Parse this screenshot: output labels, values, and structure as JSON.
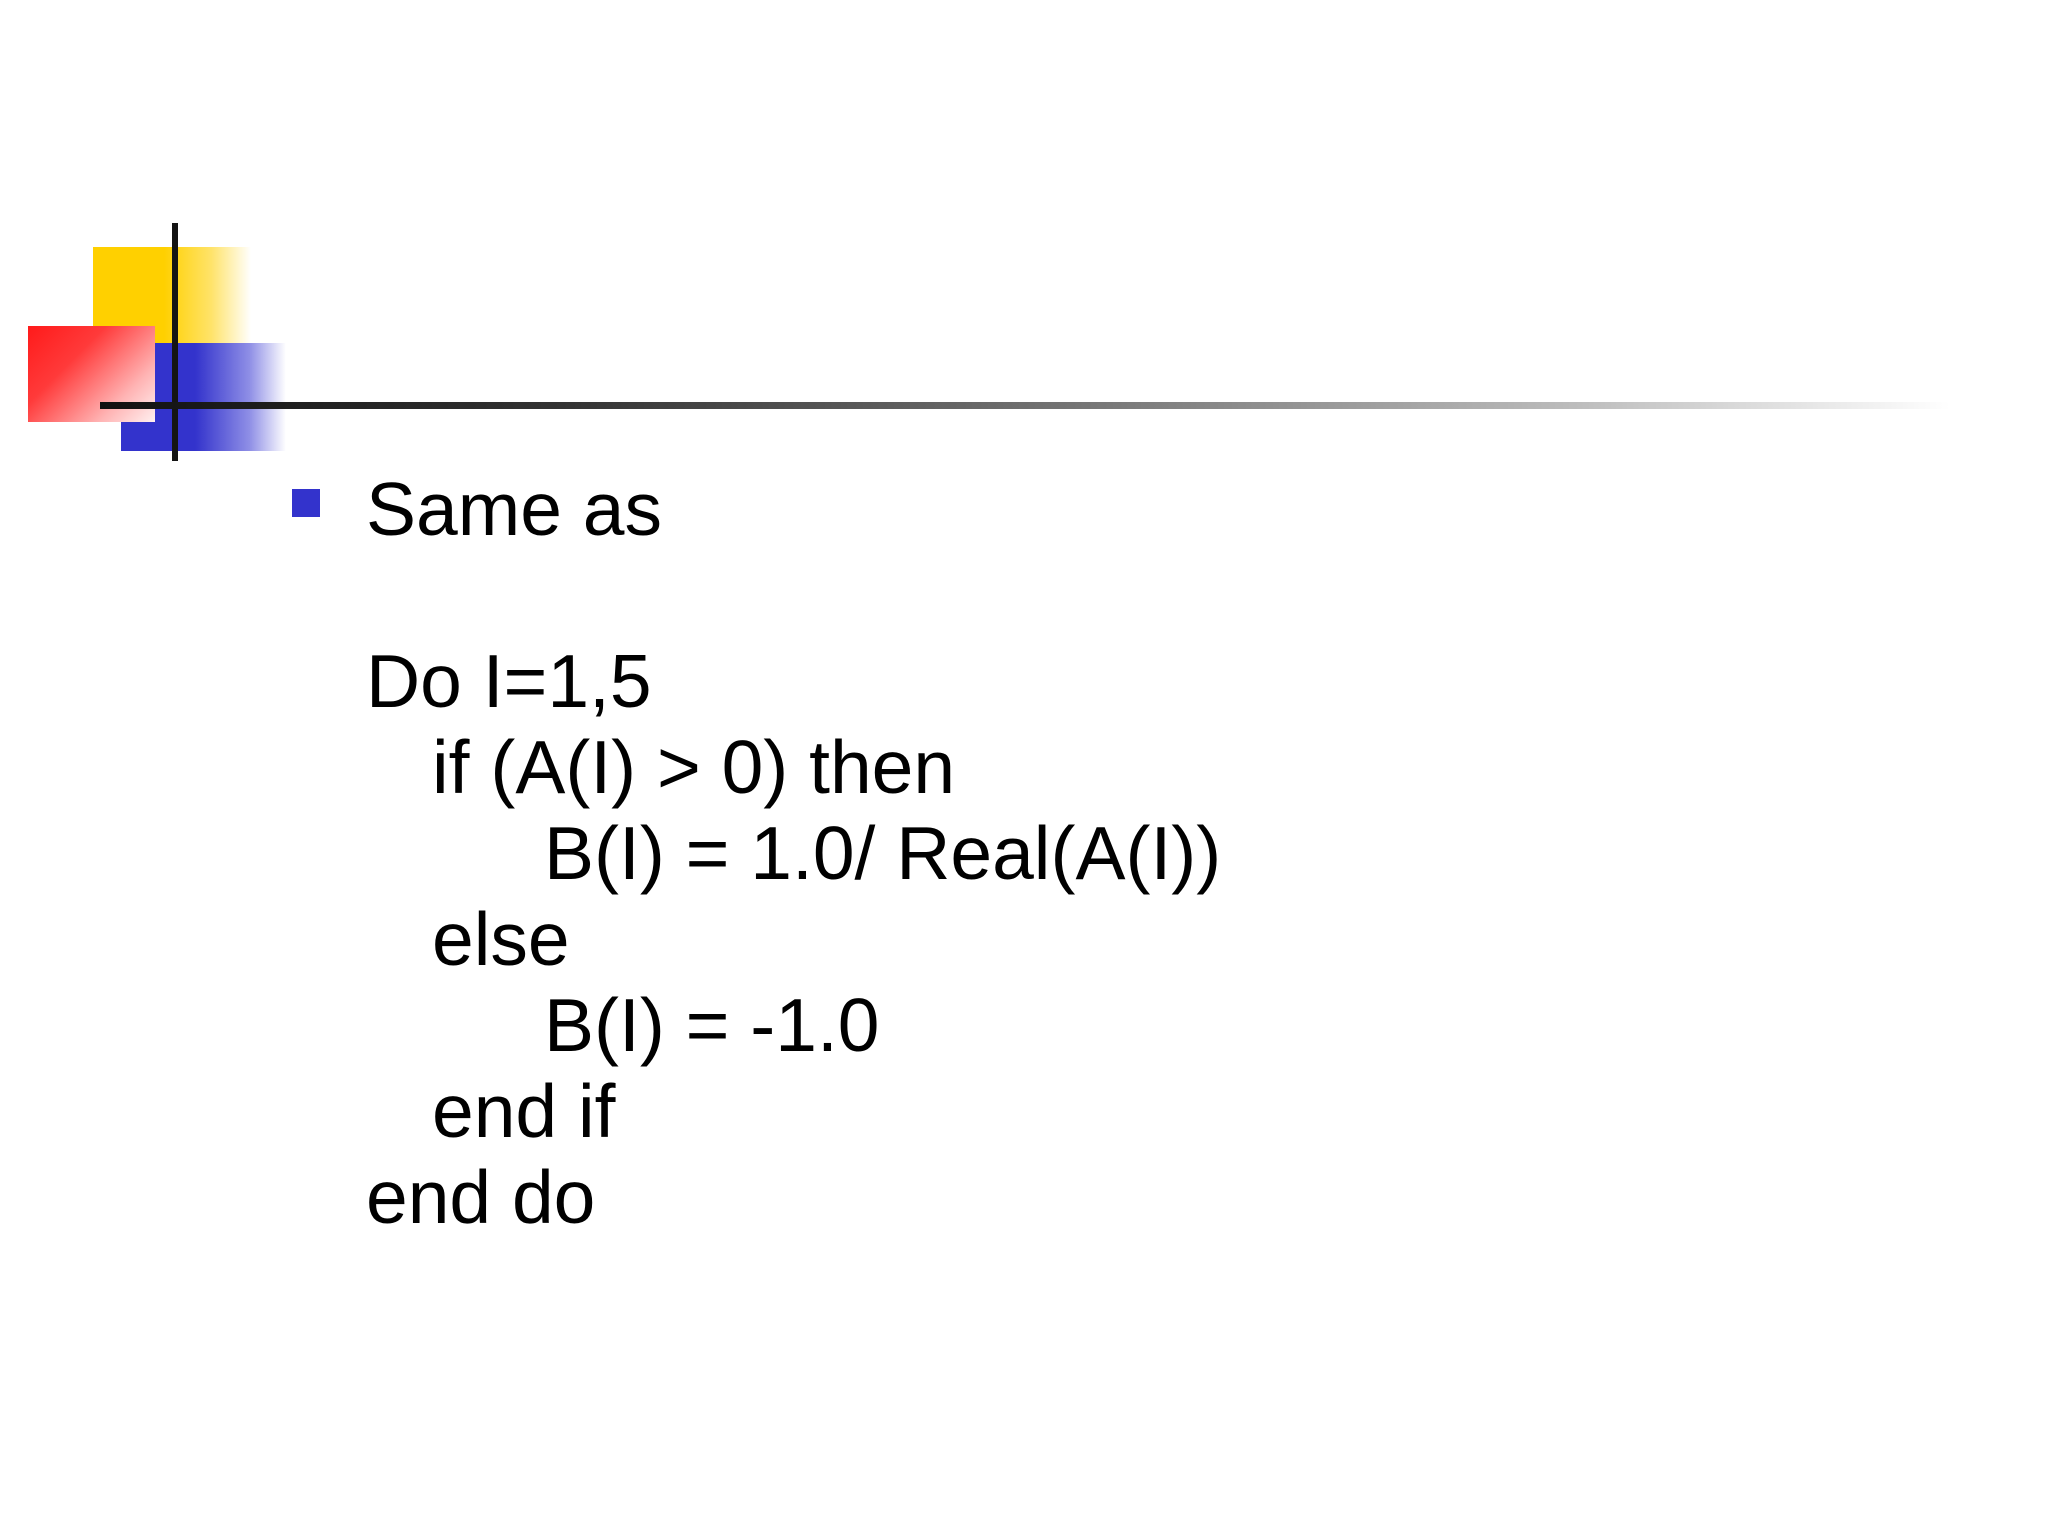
{
  "slide": {
    "bullet": {
      "text": "Same as"
    },
    "code_lines": [
      "Do I=1,5",
      "if (A(I) > 0) then",
      "B(I) = 1.0/ Real(A(I))",
      "else",
      "B(I) = -1.0",
      "end if",
      "end do"
    ]
  },
  "colors": {
    "accent_blue": "#3333cc",
    "accent_yellow": "#ffd000",
    "accent_red": "#ff1a1a",
    "rule_dark": "#111111"
  },
  "icons": {
    "bullet": "square-bullet-icon"
  }
}
